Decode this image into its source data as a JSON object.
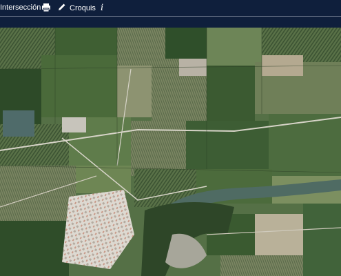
{
  "toolbar": {
    "intersection_label": "Intersección",
    "sketch_label": "Croquis",
    "info_label": "i",
    "icons": [
      "printer-icon",
      "pencil-icon",
      "info-icon"
    ]
  },
  "colors": {
    "toolbar_bg": "#0f1f3c",
    "toolbar_text": "#ffffff",
    "field_green_dark": "#2f4f2a",
    "field_green": "#4f6f3f",
    "field_light": "#8c936e",
    "river": "#4f6b63",
    "urban": "#d9d6cf"
  },
  "map": {
    "type": "aerial-orthophoto"
  }
}
